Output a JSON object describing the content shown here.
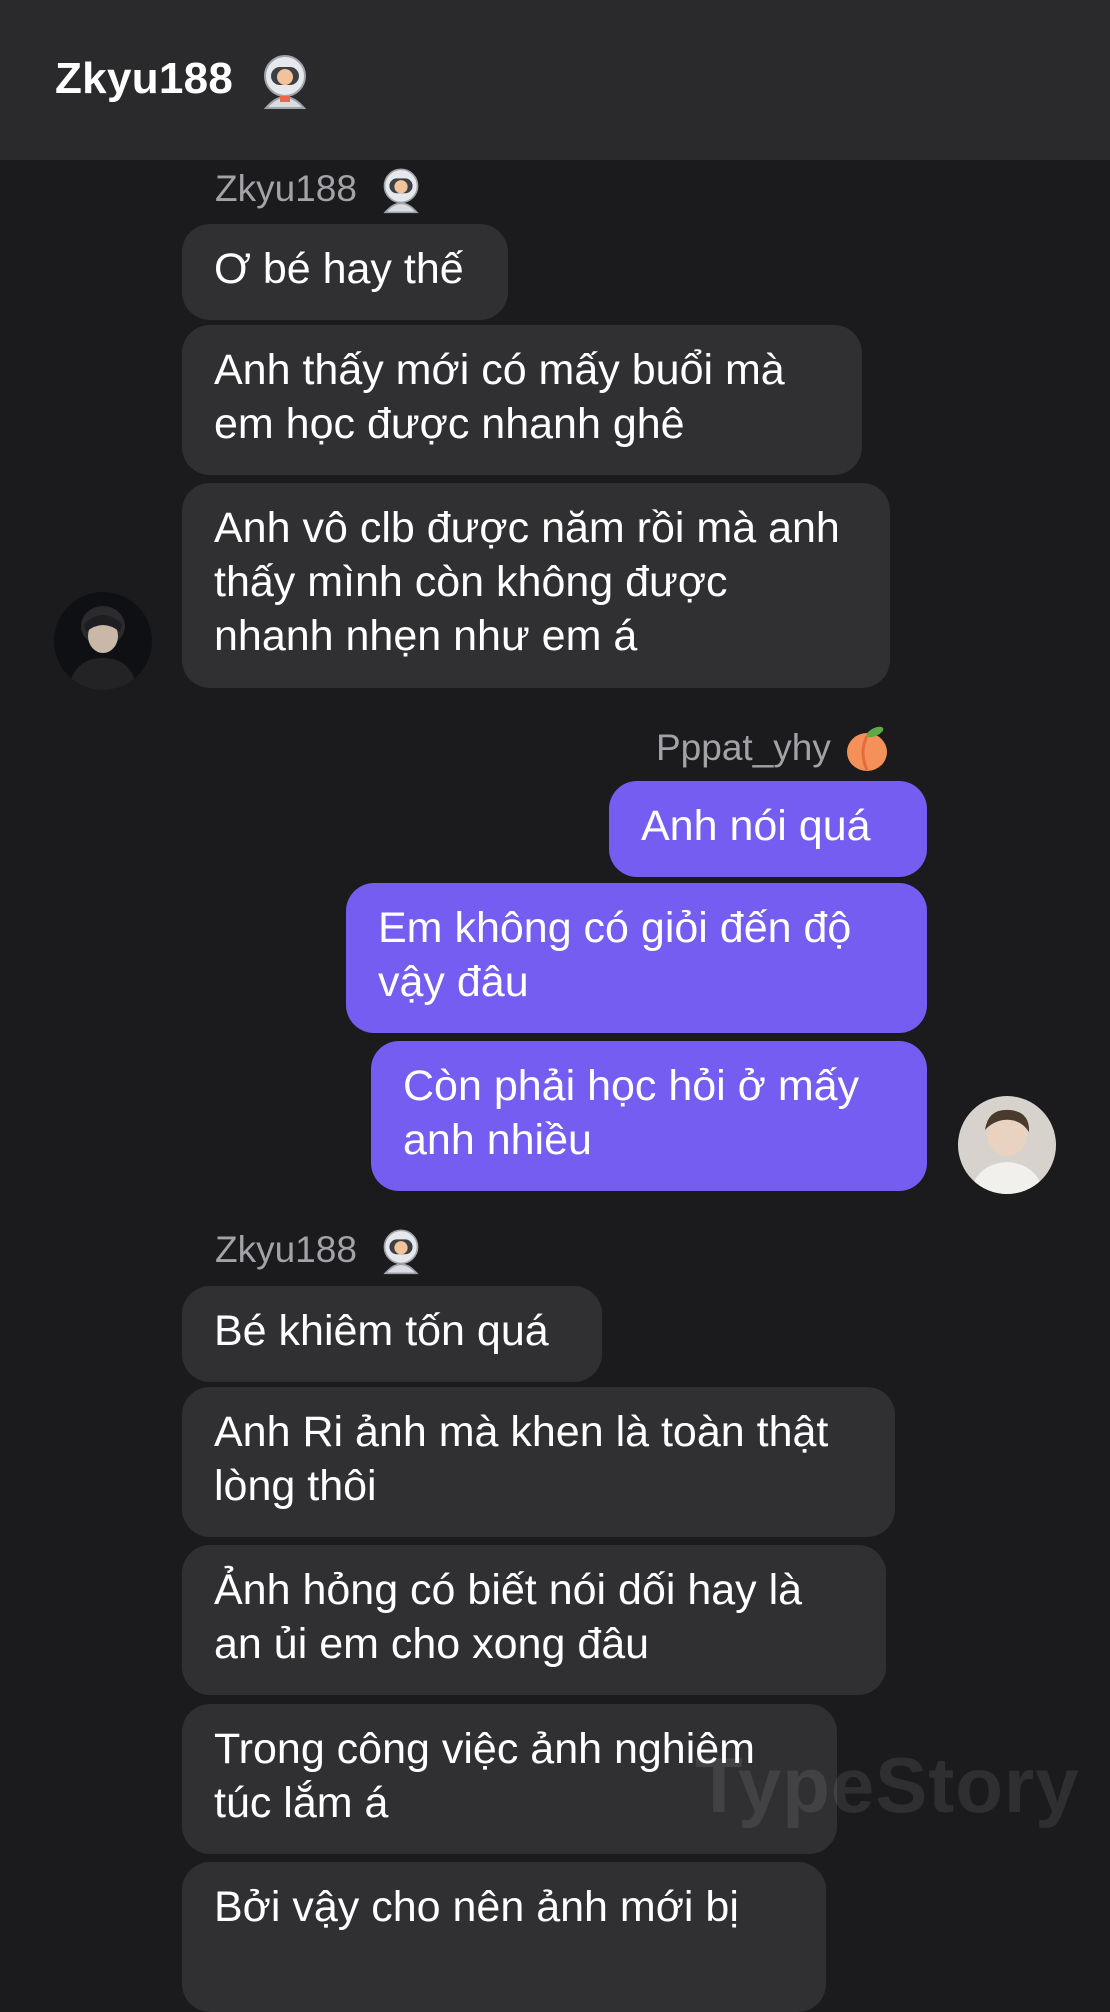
{
  "header": {
    "title": "Zkyu188",
    "emoji": "astronaut-emoji"
  },
  "groups": [
    {
      "sender": "Zkyu188",
      "side": "incoming",
      "messages": [
        "Ơ bé hay thế",
        "Anh thấy mới có mấy buổi mà em học được nhanh ghê",
        "Anh vô clb được năm rồi mà anh thấy mình còn không được nhanh nhẹn như em á"
      ]
    },
    {
      "sender": "Pppat_yhy",
      "side": "outgoing",
      "messages": [
        "Anh nói quá",
        "Em không có giỏi đến độ vậy đâu",
        "Còn phải học hỏi ở mấy anh nhiều"
      ]
    },
    {
      "sender": "Zkyu188",
      "side": "incoming",
      "messages": [
        "Bé khiêm tốn quá",
        "Anh Ri ảnh mà khen là toàn thật lòng thôi",
        "Ảnh hỏng có biết nói dối hay là an ủi em cho xong đâu",
        "Trong công việc ảnh nghiêm túc lắm á",
        "Bởi vậy cho nên ảnh mới bị"
      ]
    }
  ],
  "watermark": "TypeStory",
  "colors": {
    "incoming_bubble": "#303033",
    "outgoing_bubble": "#745df0",
    "background": "#1b1b1d",
    "header": "#2a2a2c"
  }
}
